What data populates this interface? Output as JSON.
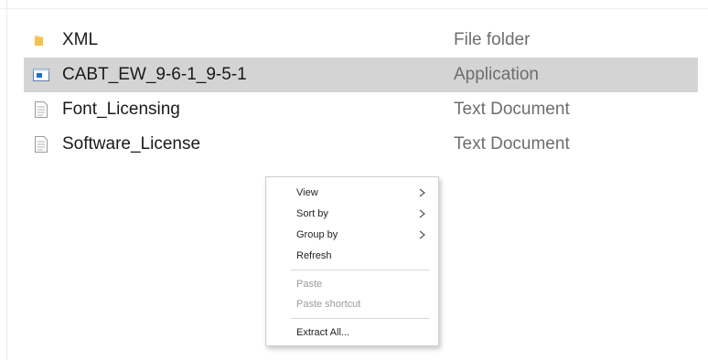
{
  "files": [
    {
      "name": "XML",
      "type": "File folder",
      "icon": "folder-icon",
      "selected": false
    },
    {
      "name": "CABT_EW_9-6-1_9-5-1",
      "type": "Application",
      "icon": "application-icon",
      "selected": true
    },
    {
      "name": "Font_Licensing",
      "type": "Text Document",
      "icon": "text-document-icon",
      "selected": false
    },
    {
      "name": "Software_License",
      "type": "Text Document",
      "icon": "text-document-icon",
      "selected": false
    }
  ],
  "context_menu": {
    "view": "View",
    "sort_by": "Sort by",
    "group_by": "Group by",
    "refresh": "Refresh",
    "paste": "Paste",
    "paste_shortcut": "Paste shortcut",
    "extract_all": "Extract All..."
  },
  "colors": {
    "selection": "#d4d4d4",
    "folder": "#f2c14e",
    "application": "#1f6fd1",
    "disabled_text": "#9a9a9a"
  }
}
